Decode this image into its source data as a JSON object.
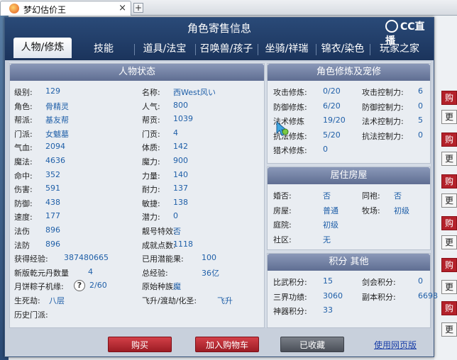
{
  "browser": {
    "tab_title": "梦幻估价王",
    "close": "×",
    "newtab": "+"
  },
  "bg": {
    "btn_gen": "更",
    "btn_buy": "购"
  },
  "dialog": {
    "title": "角色寄售信息",
    "logo": "CC直播"
  },
  "tabs": [
    "人物/修炼",
    "技能",
    "道具/法宝",
    "召唤兽/孩子",
    "坐骑/祥瑞",
    "锦衣/染色",
    "玩家之家"
  ],
  "status": {
    "title": "人物状态",
    "left": [
      {
        "label": "级别:",
        "value": "129"
      },
      {
        "label": "角色:",
        "value": "骨精灵"
      },
      {
        "label": "帮派:",
        "value": "基友帮"
      },
      {
        "label": "门派:",
        "value": "女魃墓"
      },
      {
        "label": "气血:",
        "value": "2094"
      },
      {
        "label": "魔法:",
        "value": "4636"
      },
      {
        "label": "命中:",
        "value": "352"
      },
      {
        "label": "伤害:",
        "value": "591"
      },
      {
        "label": "防御:",
        "value": "438"
      },
      {
        "label": "速度:",
        "value": "177"
      },
      {
        "label": "法伤",
        "value": "896"
      },
      {
        "label": "法防",
        "value": "896"
      },
      {
        "label": "获得经验:",
        "value": "387480665"
      },
      {
        "label": "新版乾元丹数量",
        "value": "4"
      },
      {
        "label": "月饼粽子机缘:",
        "value": "2/60"
      },
      {
        "label": "生死劫:",
        "value": "八层"
      },
      {
        "label": "历史门派:",
        "value": ""
      }
    ],
    "right": [
      {
        "label": "名称:",
        "value": "西West风い"
      },
      {
        "label": "人气:",
        "value": "800"
      },
      {
        "label": "帮贡:",
        "value": "1039"
      },
      {
        "label": "门贡:",
        "value": "4"
      },
      {
        "label": "体质:",
        "value": "142"
      },
      {
        "label": "魔力:",
        "value": "900"
      },
      {
        "label": "力量:",
        "value": "140"
      },
      {
        "label": "耐力:",
        "value": "137"
      },
      {
        "label": "敏捷:",
        "value": "138"
      },
      {
        "label": "潜力:",
        "value": "0"
      },
      {
        "label": "靓号特效:",
        "value": "否"
      },
      {
        "label": "成就点数:",
        "value": "1118"
      },
      {
        "label": "已用潜能果:",
        "value": "100"
      },
      {
        "label": "总经验:",
        "value": "36亿"
      },
      {
        "label": "原始种族:",
        "value": "魔"
      },
      {
        "label": "飞升/渡劫/化圣:",
        "value": "飞升"
      }
    ],
    "help": "?"
  },
  "cultivation": {
    "title": "角色修炼及宠修",
    "rows": [
      [
        {
          "label": "攻击修炼:",
          "value": "0/20"
        },
        {
          "label": "攻击控制力:",
          "value": "6"
        }
      ],
      [
        {
          "label": "防御修炼:",
          "value": "6/20"
        },
        {
          "label": "防御控制力:",
          "value": "0"
        }
      ],
      [
        {
          "label": "法术修炼",
          "value": "19/20"
        },
        {
          "label": "法术控制力:",
          "value": "5"
        }
      ],
      [
        {
          "label": "抗法修炼:",
          "value": "5/20"
        },
        {
          "label": "抗法控制力:",
          "value": "0"
        }
      ],
      [
        {
          "label": "猎术修炼:",
          "value": "0"
        },
        {
          "label": "",
          "value": ""
        }
      ]
    ]
  },
  "house": {
    "title": "居住房屋",
    "rows": [
      [
        {
          "label": "婚否:",
          "value": "否"
        },
        {
          "label": "同袍:",
          "value": "否"
        }
      ],
      [
        {
          "label": "房屋:",
          "value": "普通"
        },
        {
          "label": "牧场:",
          "value": "初级"
        }
      ],
      [
        {
          "label": "庭院:",
          "value": "初级"
        },
        {
          "label": "",
          "value": ""
        }
      ],
      [
        {
          "label": "社区:",
          "value": "无"
        },
        {
          "label": "",
          "value": ""
        }
      ]
    ]
  },
  "points": {
    "title": "积分 其他",
    "rows": [
      [
        {
          "label": "比武积分:",
          "value": "15"
        },
        {
          "label": "剑会积分:",
          "value": "0"
        }
      ],
      [
        {
          "label": "三界功绩:",
          "value": "3060"
        },
        {
          "label": "副本积分:",
          "value": "6698"
        }
      ],
      [
        {
          "label": "神器积分:",
          "value": "33"
        },
        {
          "label": "",
          "value": ""
        }
      ]
    ]
  },
  "footer": {
    "buy": "购买",
    "cart": "加入购物车",
    "fav": "已收藏",
    "web": "使用网页版"
  }
}
